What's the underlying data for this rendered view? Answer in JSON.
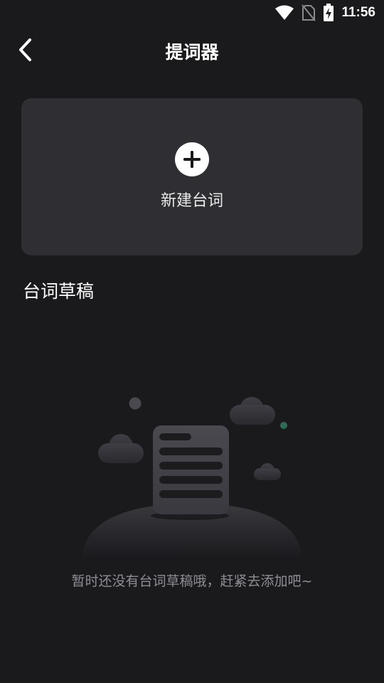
{
  "status_bar": {
    "time": "11:56",
    "icons": [
      "wifi-icon",
      "no-sim-icon",
      "battery-charging-icon"
    ]
  },
  "header": {
    "back_icon": "chevron-left-icon",
    "title": "提词器"
  },
  "new_card": {
    "icon": "plus-circle-icon",
    "label": "新建台词"
  },
  "drafts": {
    "section_title": "台词草稿",
    "empty_message": "暂时还没有台词草稿哦，赶紧去添加吧~"
  },
  "colors": {
    "background": "#1a1a1d",
    "card": "#2f2e33",
    "muted_text": "#8e8d93"
  }
}
